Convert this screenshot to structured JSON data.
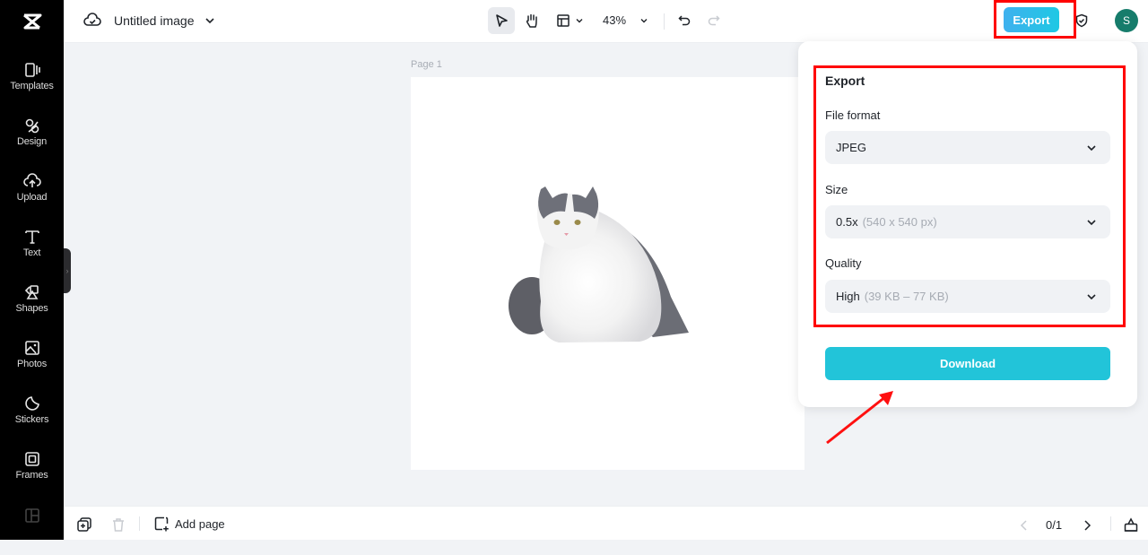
{
  "app": {
    "logo": "capcut-logo"
  },
  "sidebar": {
    "items": [
      {
        "label": "Templates",
        "icon": "templates-icon"
      },
      {
        "label": "Design",
        "icon": "design-icon"
      },
      {
        "label": "Upload",
        "icon": "upload-icon"
      },
      {
        "label": "Text",
        "icon": "text-icon"
      },
      {
        "label": "Shapes",
        "icon": "shapes-icon"
      },
      {
        "label": "Photos",
        "icon": "photos-icon"
      },
      {
        "label": "Stickers",
        "icon": "stickers-icon"
      },
      {
        "label": "Frames",
        "icon": "frames-icon"
      }
    ],
    "collapse_handle": "›"
  },
  "topbar": {
    "title": "Untitled image",
    "zoom": "43%",
    "export_label": "Export",
    "avatar_initial": "S"
  },
  "canvas": {
    "page_label": "Page 1",
    "image_subject": "fluffy white and gray cat"
  },
  "export_panel": {
    "title": "Export",
    "file_format": {
      "label": "File format",
      "value": "JPEG"
    },
    "size": {
      "label": "Size",
      "value": "0.5x",
      "detail": "(540 x 540 px)"
    },
    "quality": {
      "label": "Quality",
      "value": "High",
      "detail": "(39 KB – 77 KB)"
    },
    "download_label": "Download"
  },
  "bottombar": {
    "add_page_label": "Add page",
    "page_count": "0/1"
  },
  "colors": {
    "accent": "#22c4d9",
    "highlight": "#ff0000",
    "avatar": "#167c6b"
  }
}
